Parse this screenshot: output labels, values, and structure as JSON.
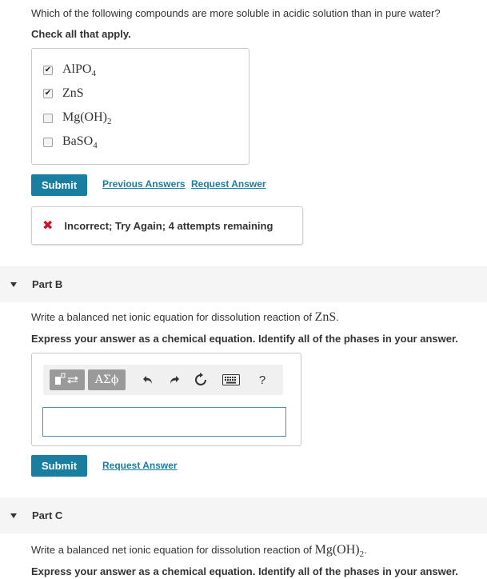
{
  "partA": {
    "question": "Which of the following compounds are more soluble in acidic solution than in pure water?",
    "instruction": "Check all that apply.",
    "choices": [
      {
        "label": "AlPO",
        "sub": "4",
        "checked": true
      },
      {
        "label": "ZnS",
        "sub": "",
        "checked": true
      },
      {
        "label": "Mg(OH)",
        "sub": "2",
        "checked": false
      },
      {
        "label": "BaSO",
        "sub": "4",
        "checked": false
      }
    ],
    "submit_label": "Submit",
    "previous_answers_label": "Previous Answers",
    "request_answer_label": "Request Answer",
    "feedback": "Incorrect; Try Again; 4 attempts remaining",
    "feedback_icon": "x-mark-icon"
  },
  "partB": {
    "title": "Part B",
    "question_prefix": "Write a balanced net ionic equation for dissolution reaction of ",
    "question_compound": "ZnS",
    "question_suffix": ".",
    "instruction": "Express your answer as a chemical equation. Identify all of the phases in your answer.",
    "toolbar": {
      "greek_label": "ΑΣϕ",
      "help_label": "?"
    },
    "answer_value": "",
    "submit_label": "Submit",
    "request_answer_label": "Request Answer"
  },
  "partC": {
    "title": "Part C",
    "question_prefix": "Write a balanced net ionic equation for dissolution reaction of ",
    "question_compound": "Mg(OH)",
    "question_compound_sub": "2",
    "question_suffix": ".",
    "instruction": "Express your answer as a chemical equation. Identify all of the phases in your answer."
  },
  "colors": {
    "accent": "#1a7ea0",
    "error": "#d0102a",
    "part_bar": "#f5f5f5"
  }
}
